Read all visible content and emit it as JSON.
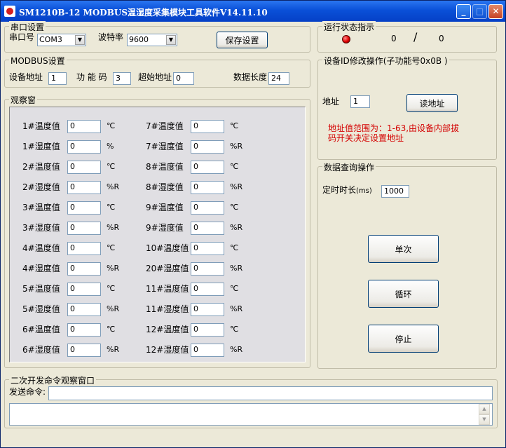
{
  "window": {
    "title": "SM1210B-12 MODBUS温湿度采集模块工具软件V14.11.10"
  },
  "serial": {
    "legend": "串口设置",
    "port_label": "串口号",
    "port_value": "COM3",
    "baud_label": "波特率",
    "baud_value": "9600",
    "save_label": "保存设置"
  },
  "status": {
    "legend": "运行状态指示",
    "count_left": "0",
    "separator": "/",
    "count_right": "0",
    "led_color": "#e00000"
  },
  "modbus": {
    "legend": "MODBUS设置",
    "device_addr_label": "设备地址",
    "device_addr_value": "1",
    "func_code_label": "功 能 码",
    "func_code_value": "3",
    "start_addr_label": "超始地址",
    "start_addr_value": "0",
    "data_len_label": "数据长度",
    "data_len_value": "24"
  },
  "id_modify": {
    "legend": "设备ID修改操作(子功能号0x0B )",
    "addr_label": "地址",
    "addr_value": "1",
    "read_addr_label": "读地址",
    "note_line1": "地址值范围为：1-63,由设备内部拔",
    "note_line2": "码开关决定设置地址",
    "note_color": "#d40000"
  },
  "observe": {
    "legend": "观察窗",
    "rows": [
      {
        "l_label": "1#温度值",
        "l_value": "0",
        "l_unit": "℃",
        "r_label": "7#温度值",
        "r_value": "0",
        "r_unit": "℃"
      },
      {
        "l_label": "1#湿度值",
        "l_value": "0",
        "l_unit": "%",
        "r_label": "7#湿度值",
        "r_value": "0",
        "r_unit": "%R"
      },
      {
        "l_label": "2#温度值",
        "l_value": "0",
        "l_unit": "℃",
        "r_label": "8#温度值",
        "r_value": "0",
        "r_unit": "℃"
      },
      {
        "l_label": "2#湿度值",
        "l_value": "0",
        "l_unit": "%R",
        "r_label": "8#湿度值",
        "r_value": "0",
        "r_unit": "%R"
      },
      {
        "l_label": "3#温度值",
        "l_value": "0",
        "l_unit": "℃",
        "r_label": "9#温度值",
        "r_value": "0",
        "r_unit": "℃"
      },
      {
        "l_label": "3#湿度值",
        "l_value": "0",
        "l_unit": "%R",
        "r_label": "9#湿度值",
        "r_value": "0",
        "r_unit": "%R"
      },
      {
        "l_label": "4#温度值",
        "l_value": "0",
        "l_unit": "℃",
        "r_label": "10#温度值",
        "r_value": "0",
        "r_unit": "℃"
      },
      {
        "l_label": "4#湿度值",
        "l_value": "0",
        "l_unit": "%R",
        "r_label": "20#湿度值",
        "r_value": "0",
        "r_unit": "%R"
      },
      {
        "l_label": "5#温度值",
        "l_value": "0",
        "l_unit": "℃",
        "r_label": "11#温度值",
        "r_value": "0",
        "r_unit": "℃"
      },
      {
        "l_label": "5#湿度值",
        "l_value": "0",
        "l_unit": "%R",
        "r_label": "11#湿度值",
        "r_value": "0",
        "r_unit": "%R"
      },
      {
        "l_label": "6#温度值",
        "l_value": "0",
        "l_unit": "℃",
        "r_label": "12#温度值",
        "r_value": "0",
        "r_unit": "℃"
      },
      {
        "l_label": "6#湿度值",
        "l_value": "0",
        "l_unit": "%R",
        "r_label": "12#湿度值",
        "r_value": "0",
        "r_unit": "%R"
      }
    ]
  },
  "query": {
    "legend": "数据查询操作",
    "timer_label": "定时时长",
    "timer_unit": "(ms)",
    "timer_value": "1000",
    "single_label": "单次",
    "loop_label": "循环",
    "stop_label": "停止"
  },
  "dev": {
    "legend": "二次开发命令观察窗口",
    "send_label": "发送命令:",
    "send_value": "",
    "log_value": ""
  }
}
